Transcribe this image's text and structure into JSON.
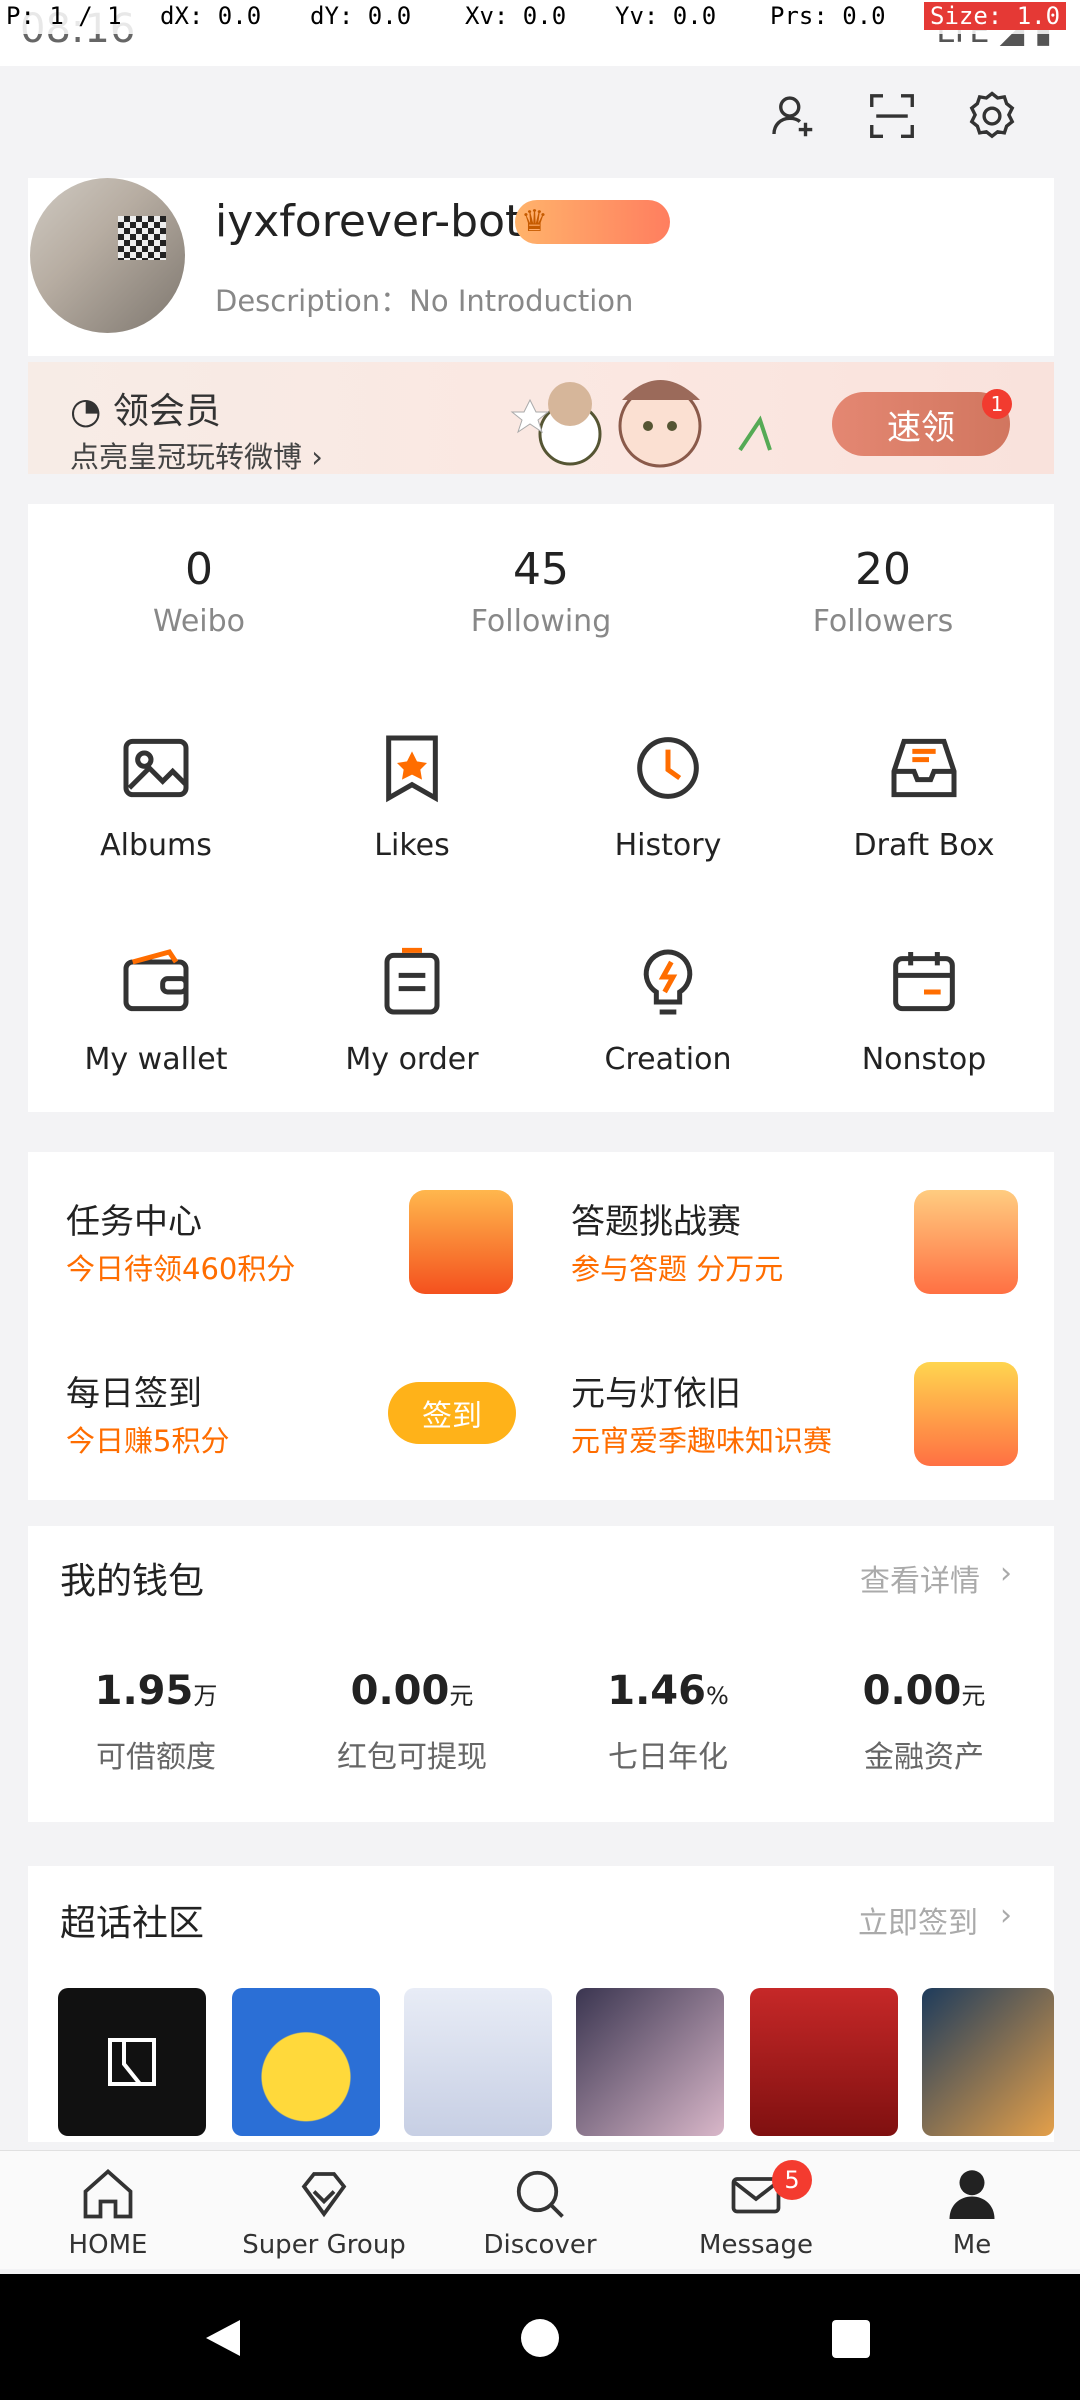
{
  "status_bar": {
    "time": "08:16",
    "icons": "LTE ◢ ▮"
  },
  "pointer_overlay": {
    "p": "P: 1 / 1",
    "dx": "dX: 0.0",
    "dy": "dY: 0.0",
    "xv": "Xv: 0.0",
    "yv": "Yv: 0.0",
    "prs": "Prs: 0.0",
    "size": "Size: 1.0"
  },
  "header": {
    "icons": [
      "add-friend-icon",
      "scan-icon",
      "settings-icon"
    ]
  },
  "profile": {
    "username": "iyxforever-bot",
    "description": "Description：No Introduction"
  },
  "vip_banner": {
    "title": "领会员",
    "subtitle": "点亮皇冠玩转微博 ›",
    "button_label": "速领",
    "badge_count": "1"
  },
  "stats": [
    {
      "value": "0",
      "label": "Weibo"
    },
    {
      "value": "45",
      "label": "Following"
    },
    {
      "value": "20",
      "label": "Followers"
    }
  ],
  "tools": [
    {
      "label": "Albums",
      "icon": "image-icon"
    },
    {
      "label": "Likes",
      "icon": "star-bookmark-icon"
    },
    {
      "label": "History",
      "icon": "clock-icon"
    },
    {
      "label": "Draft Box",
      "icon": "inbox-icon"
    },
    {
      "label": "My wallet",
      "icon": "wallet-icon"
    },
    {
      "label": "My order",
      "icon": "order-icon"
    },
    {
      "label": "Creation",
      "icon": "lightbulb-icon"
    },
    {
      "label": "Nonstop",
      "icon": "calendar-icon"
    }
  ],
  "tasks": [
    {
      "title": "任务中心",
      "subtitle": "今日待领460积分"
    },
    {
      "title": "答题挑战赛",
      "subtitle": "参与答题 分万元"
    },
    {
      "title": "每日签到",
      "subtitle": "今日赚5积分",
      "button": "签到"
    },
    {
      "title": "元与灯依旧",
      "subtitle": "元宵爱季趣味知识赛"
    }
  ],
  "wallet": {
    "title": "我的钱包",
    "link": "查看详情",
    "cells": [
      {
        "value": "1.95",
        "unit": "万",
        "label": "可借额度"
      },
      {
        "value": "0.00",
        "unit": "元",
        "label": "红包可提现"
      },
      {
        "value": "1.46",
        "unit": "%",
        "label": "七日年化"
      },
      {
        "value": "0.00",
        "unit": "元",
        "label": "金融资产"
      }
    ]
  },
  "community": {
    "title": "超话社区",
    "link": "立即签到"
  },
  "bottom_nav": [
    {
      "label": "HOME",
      "icon": "home-icon"
    },
    {
      "label": "Super Group",
      "icon": "diamond-icon"
    },
    {
      "label": "Discover",
      "icon": "search-icon"
    },
    {
      "label": "Message",
      "icon": "mail-icon",
      "badge": "5"
    },
    {
      "label": "Me",
      "icon": "person-icon"
    }
  ],
  "colors": {
    "accent_orange": "#ff6d00",
    "vip_button": "#e48772",
    "badge_red": "#f23b2f"
  }
}
